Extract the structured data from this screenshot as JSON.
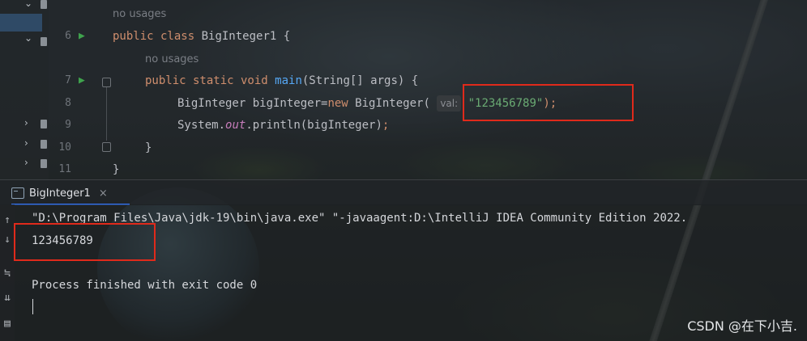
{
  "editor": {
    "usage_hint_class": "no usages",
    "usage_hint_method": "no usages",
    "lines": [
      {
        "num": "6"
      },
      {
        "num": "7"
      },
      {
        "num": "8"
      },
      {
        "num": "9"
      },
      {
        "num": "10"
      },
      {
        "num": "11"
      }
    ],
    "param_hint": "val:",
    "string_value": "\"123456789\""
  },
  "console": {
    "tab_label": "BigInteger1",
    "tab_close": "×",
    "command_line": "\"D:\\Program Files\\Java\\jdk-19\\bin\\java.exe\" \"-javaagent:D:\\IntelliJ IDEA Community Edition 2022.",
    "output": "123456789",
    "exit_message": "Process finished with exit code 0"
  },
  "watermark": "CSDN @在下小吉.",
  "colors": {
    "accent": "#3574f0",
    "highlight_box": "#e02a1b",
    "keyword": "#cf8e6d",
    "string": "#6aab73"
  }
}
